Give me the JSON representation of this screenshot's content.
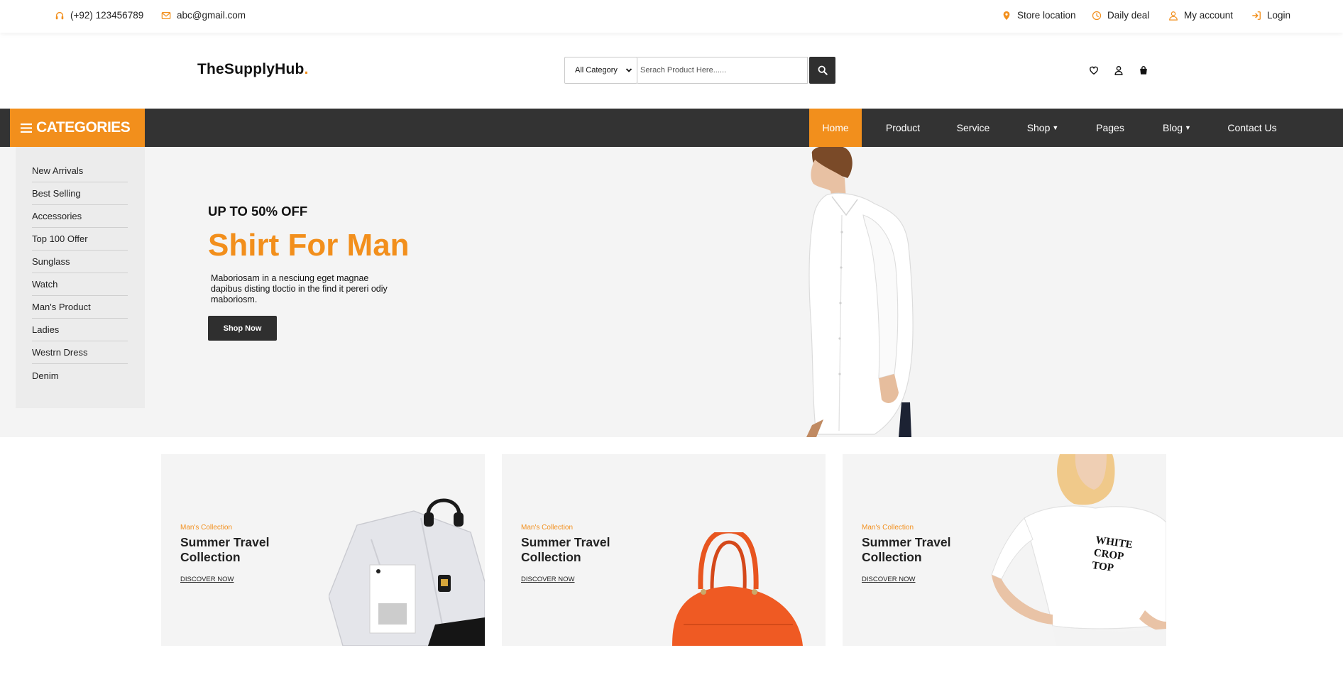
{
  "topbar": {
    "phone": "(+92) 123456789",
    "email": "abc@gmail.com",
    "links": [
      "Store location",
      "Daily deal",
      "My account",
      "Login"
    ]
  },
  "header": {
    "logo_text": "TheSupplyHub",
    "logo_dot": ".",
    "category_select": "All Category",
    "search_placeholder": "Serach Product Here......"
  },
  "nav": {
    "categories_label": "CATEGORIES",
    "items": [
      "Home",
      "Product",
      "Service",
      "Shop",
      "Pages",
      "Blog",
      "Contact Us"
    ],
    "active": "Home"
  },
  "sidebar": {
    "items": [
      "New Arrivals",
      "Best Selling",
      "Accessories",
      "Top 100 Offer",
      "Sunglass",
      "Watch",
      "Man's Product",
      "Ladies",
      "Westrn Dress",
      "Denim"
    ]
  },
  "hero": {
    "subtitle": "UP TO 50% OFF",
    "title": "Shirt For Man",
    "description": "Maboriosam in a nesciung eget magnae dapibus disting tloctio in the find it pereri odiy maboriosm.",
    "button": "Shop Now"
  },
  "cards": [
    {
      "tag": "Man's Collection",
      "title": "Summer Travel Collection",
      "link": "DISCOVER NOW"
    },
    {
      "tag": "Man's Collection",
      "title": "Summer Travel Collection",
      "link": "DISCOVER NOW"
    },
    {
      "tag": "Man's Collection",
      "title": "Summer Travel Collection",
      "link": "DISCOVER NOW",
      "shirt_print": "WHITE CROP TOP"
    }
  ],
  "colors": {
    "accent": "#f28f1c",
    "dark": "#333333",
    "hero_bg": "#f4f4f4"
  }
}
